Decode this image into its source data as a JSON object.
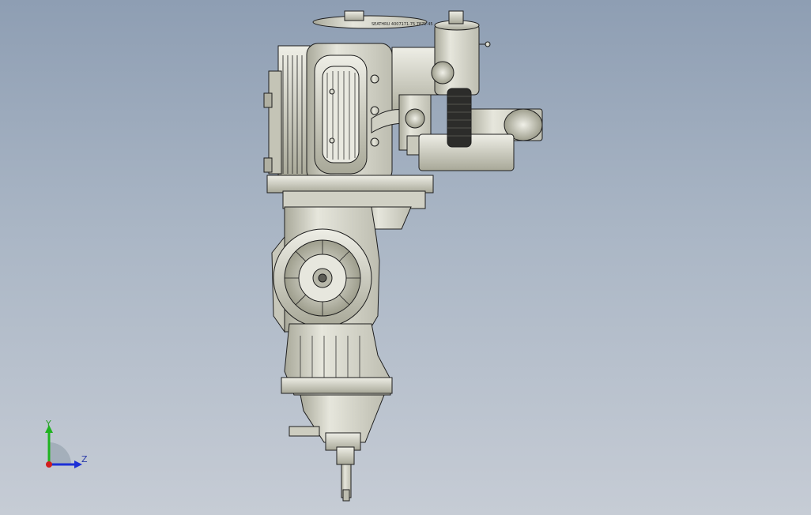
{
  "viewport": {
    "background_top": "#8e9eb3",
    "background_bottom": "#c6ccd5",
    "model_stroke": "#1e1e1e",
    "model_fill": "#d8d8cf",
    "model_shadow": "#aeae9f"
  },
  "model": {
    "description_icon": "engine-transmission-assembly",
    "nameplate_text": "SEATHRU 4007171.75 7871-45"
  },
  "triad": {
    "y_label": "Y",
    "z_label": "Z",
    "y_color": "#1fb31f",
    "z_color": "#1c2fd6",
    "x_color": "#d21f1f"
  }
}
